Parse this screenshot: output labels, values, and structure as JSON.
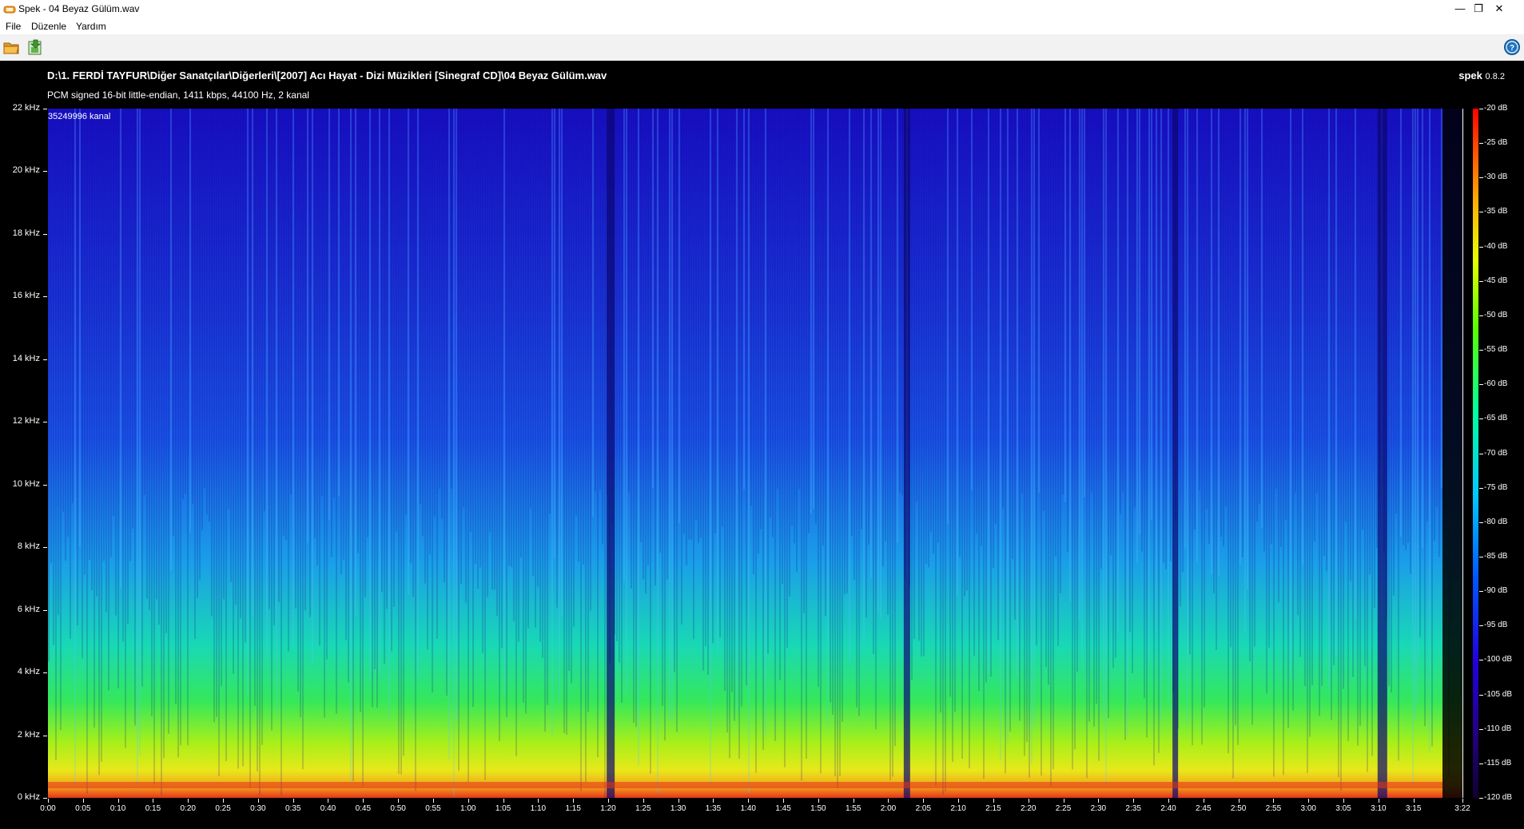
{
  "window": {
    "title": "Spek - 04 Beyaz Gülüm.wav",
    "controls": [
      "—",
      "❐",
      "✕"
    ]
  },
  "menu": [
    "File",
    "Düzenle",
    "Yardım"
  ],
  "toolbar": {
    "open_icon": "folder-open-icon",
    "save_icon": "save-image-icon",
    "help_icon": "help-icon"
  },
  "spek": {
    "file_path": "D:\\1. FERDİ TAYFUR\\Diğer Sanatçılar\\Diğerleri\\[2007] Acı Hayat - Dizi Müzikleri [Sinegraf CD]\\04 Beyaz Gülüm.wav",
    "file_info": "PCM signed 16-bit little-endian, 1411 kbps, 44100 Hz, 2 kanal",
    "brand": "spek",
    "version": "0.8.2",
    "overlay_label": "35249996 kanal"
  },
  "y_axis_labels": [
    "22 kHz",
    "20 kHz",
    "18 kHz",
    "16 kHz",
    "14 kHz",
    "12 kHz",
    "10 kHz",
    "8 kHz",
    "6 kHz",
    "4 kHz",
    "2 kHz",
    "0 kHz"
  ],
  "x_axis_labels": [
    "0:00",
    "0:05",
    "0:10",
    "0:15",
    "0:20",
    "0:25",
    "0:30",
    "0:35",
    "0:40",
    "0:45",
    "0:50",
    "0:55",
    "1:00",
    "1:05",
    "1:10",
    "1:15",
    "1:20",
    "1:25",
    "1:30",
    "1:35",
    "1:40",
    "1:45",
    "1:50",
    "1:55",
    "2:00",
    "2:05",
    "2:10",
    "2:15",
    "2:20",
    "2:25",
    "2:30",
    "2:35",
    "2:40",
    "2:45",
    "2:50",
    "2:55",
    "3:00",
    "3:05",
    "3:10",
    "3:15",
    "3:22"
  ],
  "db_labels": [
    "-20 dB",
    "-25 dB",
    "-30 dB",
    "-35 dB",
    "-40 dB",
    "-45 dB",
    "-50 dB",
    "-55 dB",
    "-60 dB",
    "-65 dB",
    "-70 dB",
    "-75 dB",
    "-80 dB",
    "-85 dB",
    "-90 dB",
    "-95 dB",
    "-100 dB",
    "-105 dB",
    "-110 dB",
    "-115 dB",
    "-120 dB"
  ],
  "colors": {
    "background": "#000000",
    "text": "#ffffff",
    "help_icon": "#1e73be"
  }
}
